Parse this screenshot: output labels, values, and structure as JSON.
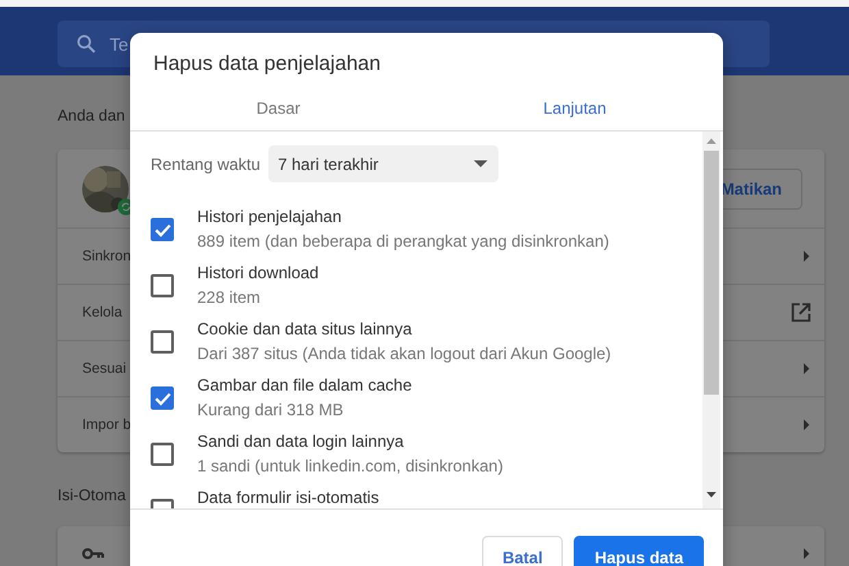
{
  "page": {
    "search": {
      "placeholder": "Te"
    },
    "section_title": "Anda dan",
    "account": {
      "button": "Matikan"
    },
    "rows": [
      {
        "label": "Sinkron",
        "kind": "arrow"
      },
      {
        "label": "Kelola",
        "kind": "external"
      },
      {
        "label": "Sesuai",
        "kind": "arrow"
      },
      {
        "label": "Impor b",
        "kind": "arrow"
      }
    ],
    "section2_title": "Isi-Otoma"
  },
  "dialog": {
    "title": "Hapus data penjelajahan",
    "tabs": [
      {
        "label": "Dasar",
        "selected": false
      },
      {
        "label": "Lanjutan",
        "selected": true
      }
    ],
    "time_range": {
      "label": "Rentang waktu",
      "value": "7 hari terakhir"
    },
    "items": [
      {
        "title": "Histori penjelajahan",
        "detail": "889 item (dan beberapa di perangkat yang disinkronkan)",
        "checked": true
      },
      {
        "title": "Histori download",
        "detail": "228 item",
        "checked": false
      },
      {
        "title": "Cookie dan data situs lainnya",
        "detail": "Dari 387 situs (Anda tidak akan logout dari Akun Google)",
        "checked": false
      },
      {
        "title": "Gambar dan file dalam cache",
        "detail": "Kurang dari 318 MB",
        "checked": true
      },
      {
        "title": "Sandi dan data login lainnya",
        "detail": "1 sandi (untuk linkedin.com, disinkronkan)",
        "checked": false
      },
      {
        "title": "Data formulir isi-otomatis",
        "checked": false
      }
    ],
    "buttons": [
      {
        "label": "Batal",
        "kind": "secondary"
      },
      {
        "label": "Hapus data",
        "kind": "primary"
      }
    ]
  }
}
